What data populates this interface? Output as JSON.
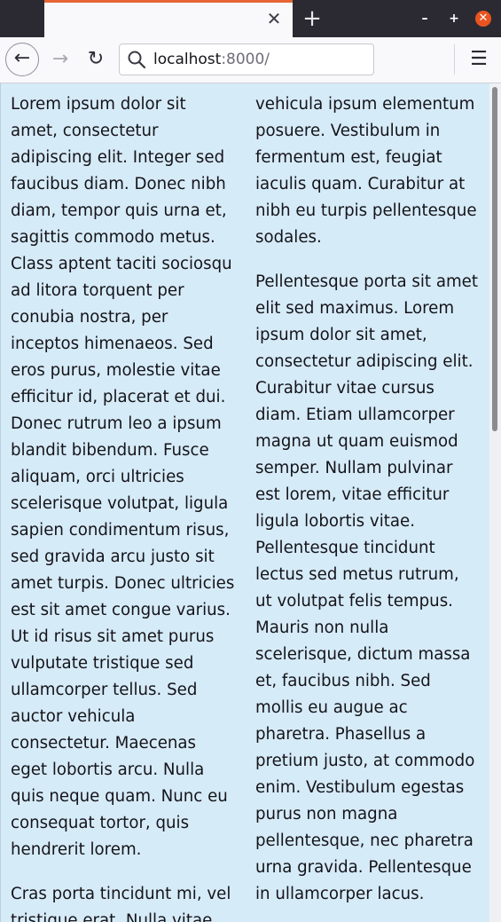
{
  "browser": {
    "tab_close_glyph": "✕",
    "new_tab_glyph": "+",
    "window": {
      "minimize": "–",
      "maximize": "+",
      "close": "✕"
    },
    "nav": {
      "back": "←",
      "forward": "→",
      "reload": "↻",
      "menu": "☰"
    },
    "url": {
      "host": "localhost",
      "port_path": ":8000/"
    },
    "accent_color": "#e76636",
    "close_color": "#e95420"
  },
  "page": {
    "background": "#d6ebf8",
    "paragraphs": [
      "Lorem ipsum dolor sit amet, consectetur adipiscing elit. Integer sed faucibus diam. Donec nibh diam, tempor quis urna et, sagittis commodo metus. Class aptent taciti sociosqu ad litora torquent per conubia nostra, per inceptos himenaeos. Sed eros purus, molestie vitae efficitur id, placerat et dui. Donec rutrum leo a ipsum blandit bibendum. Fusce aliquam, orci ultricies scelerisque volutpat, ligula sapien condimentum risus, sed gravida arcu justo sit amet turpis. Donec ultricies est sit amet congue varius. Ut id risus sit amet purus vulputate tristique sed ullamcorper tellus. Sed auctor vehicula consectetur. Maecenas eget lobortis arcu. Nulla quis neque quam. Nunc eu consequat tortor, quis hendrerit lorem.",
      "Cras porta tincidunt mi, vel tristique erat. Nulla vitae vehicula ipsum elementum posuere. Vestibulum in fermentum est, feugiat iaculis quam. Curabitur at nibh eu turpis pellentesque sodales.",
      "Pellentesque porta sit amet elit sed maximus. Lorem ipsum dolor sit amet, consectetur adipiscing elit. Curabitur vitae cursus diam. Etiam ullamcorper magna ut quam euismod semper. Nullam pulvinar est lorem, vitae efficitur ligula lobortis vitae. Pellentesque tincidunt lectus sed metus rutrum, ut volutpat felis tempus. Mauris non nulla scelerisque, dictum massa et, faucibus nibh. Sed mollis eu augue ac pharetra. Phasellus a pretium justo, at commodo enim. Vestibulum egestas purus non magna pellentesque, nec pharetra urna gravida. Pellentesque in ullamcorper lacus."
    ]
  }
}
